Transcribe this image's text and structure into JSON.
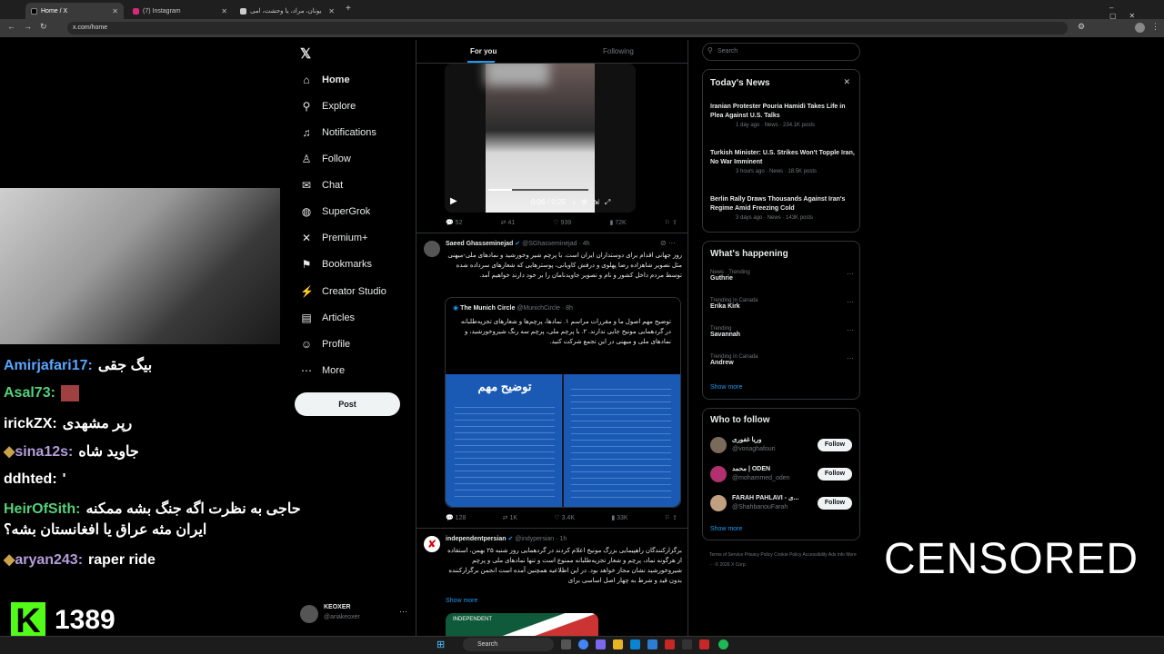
{
  "browser": {
    "tabs": [
      {
        "title": "Home / X",
        "favicon_color": "#000000"
      },
      {
        "title": "(7) Instagram",
        "favicon_color": "#d62976"
      },
      {
        "title": "یونان، مراد، یا وحشت، امی",
        "favicon_color": "#cccccc"
      }
    ],
    "url": "x.com/home"
  },
  "stream": {
    "chat": [
      {
        "user": "Amirjafari17:",
        "message": "بیگ جقی",
        "color": "#58a6ff"
      },
      {
        "user": "Asal73:",
        "message": "",
        "color": "#54d17a"
      },
      {
        "user": "irickZX:",
        "message": "رپر مشهدی",
        "color": "#ffffff"
      },
      {
        "user": "sina12s:",
        "message": "جاوید شاه",
        "color": "#b39ddb"
      },
      {
        "user": "ddhted:",
        "message": "'",
        "color": "#ffffff"
      },
      {
        "user": "HeirOfSith:",
        "message": "حاجی به نظرت اگه جنگ بشه ممکنه",
        "color": "#54d17a"
      },
      {
        "user": "",
        "message": "ایران مثه عراق یا افغانستان بشه؟",
        "color": "#ffffff"
      },
      {
        "user": "aryan243:",
        "message": "raper ride",
        "color": "#b39ddb"
      }
    ],
    "viewers": "1389",
    "platform_letter": "K",
    "censored_label": "CENSORED"
  },
  "nav": {
    "items": [
      {
        "label": "Home",
        "icon": "home-icon",
        "glyph": "⌂"
      },
      {
        "label": "Explore",
        "icon": "search-icon",
        "glyph": "⚲"
      },
      {
        "label": "Notifications",
        "icon": "bell-icon",
        "glyph": "♫"
      },
      {
        "label": "Follow",
        "icon": "add-user-icon",
        "glyph": "♙"
      },
      {
        "label": "Chat",
        "icon": "mail-icon",
        "glyph": "✉"
      },
      {
        "label": "SuperGrok",
        "icon": "grok-icon",
        "glyph": "◍"
      },
      {
        "label": "Premium+",
        "icon": "x-logo-icon",
        "glyph": "✕"
      },
      {
        "label": "Bookmarks",
        "icon": "bookmark-icon",
        "glyph": "⚑"
      },
      {
        "label": "Creator Studio",
        "icon": "creator-icon",
        "glyph": "⚡"
      },
      {
        "label": "Articles",
        "icon": "article-icon",
        "glyph": "▤"
      },
      {
        "label": "Profile",
        "icon": "profile-icon",
        "glyph": "☺"
      },
      {
        "label": "More",
        "icon": "more-icon",
        "glyph": "⋯"
      }
    ],
    "post_label": "Post",
    "account_name": "KEOXER",
    "account_handle": "@ariakeoxer"
  },
  "feed": {
    "tabs": [
      "For you",
      "Following"
    ],
    "video": {
      "time": "0:06 / 0:25"
    },
    "tweet1_actions": {
      "replies": "52",
      "retweets": "41",
      "likes": "939",
      "views": "72K"
    },
    "tweet2": {
      "name": "Saeed Ghasseminejad",
      "handle": "@SGhasseminejad · 4h",
      "text": "روز جهانی اقدام برای دوستداران ایران است. با پرچم شیر وخورشید و نمادهای ملی-میهنی مثل تصویر شاهزاده رضا پهلوی و درفش کاویانی، پوسترهایی که شعارهای سرداده شده توسط مردم داخل کشور و نام و تصویر جاویدنامان را بر خود دارند خواهیم آمد.",
      "quote_name": "The Munich Circle",
      "quote_handle": "@MunichCircle · 8h",
      "quote_text": "توضیح مهم اصول ما و مقررات مراسم ۱. نمادها، پرچم‌ها و شعارهای تجزیه‌طلبانه در گردهمایی مونیخ جایی ندارند. ۲. با پرچم ملی، پرچم سه رنگ شیروخورشید، و نمادهای ملی و میهنی در این تجمع شرکت کنید.",
      "image_heading": "توضیح مهم",
      "actions": {
        "replies": "128",
        "retweets": "1K",
        "likes": "3.4K",
        "views": "33K"
      }
    },
    "tweet3": {
      "name": "independentpersian",
      "handle": "@indypersian · 1h",
      "text": "برگزارکنندگان راهپیمایی بزرگ مونیخ اعلام کردند در گردهمایی روز شنبه ۲۵ بهمن، استفاده از هرگونه نماد، پرچم و شعار تجزیه‌طلبانه ممنوع است و تنها نمادهای ملی و پرچم شیروخورشید نشان مجاز خواهد بود. در این اطلاعیه همچنین آمده است انجمن برگزارکننده بدون قید و شرط به چهار اصل اساسی برای",
      "show_more": "Show more",
      "image_label": "INDEPENDENT"
    }
  },
  "sidebar": {
    "search_placeholder": "Search",
    "news_title": "Today's News",
    "news": [
      {
        "title": "Iranian Protester Pouria Hamidi Takes Life in Plea Against U.S. Talks",
        "meta": "1 day ago · News · 234.1K posts"
      },
      {
        "title": "Turkish Minister: U.S. Strikes Won't Topple Iran, No War Imminent",
        "meta": "3 hours ago · News · 18.5K posts"
      },
      {
        "title": "Berlin Rally Draws Thousands Against Iran's Regime Amid Freezing Cold",
        "meta": "3 days ago · News · 143K posts"
      }
    ],
    "happening_title": "What's happening",
    "trends": [
      {
        "context": "News · Trending",
        "name": "Guthrie"
      },
      {
        "context": "Trending in Canada",
        "name": "Erika Kirk"
      },
      {
        "context": "Trending",
        "name": "Savannah"
      },
      {
        "context": "Trending in Canada",
        "name": "Andrew"
      }
    ],
    "show_more": "Show more",
    "who_title": "Who to follow",
    "who": [
      {
        "name": "وریا غفوری",
        "handle": "@voriaghafouri",
        "color": "#7a6a5a"
      },
      {
        "name": "محمد | ODEN",
        "handle": "@mohammed_oden",
        "color": "#b03070"
      },
      {
        "name": "FARAH PAHLAVI - ی...",
        "handle": "@ShahbanouFarah",
        "color": "#c0a080"
      }
    ],
    "follow_label": "Follow",
    "footer": "Terms of Service  Privacy Policy  Cookie Policy  Accessibility  Ads info  More ···  © 2026 X Corp."
  },
  "taskbar": {
    "search": "Search"
  }
}
